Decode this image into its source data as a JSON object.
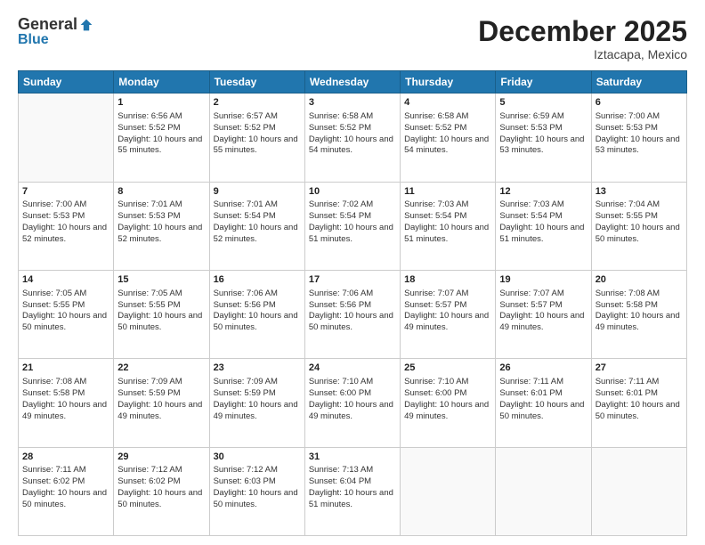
{
  "header": {
    "logo_general": "General",
    "logo_blue": "Blue",
    "month": "December 2025",
    "location": "Iztacapa, Mexico"
  },
  "days_of_week": [
    "Sunday",
    "Monday",
    "Tuesday",
    "Wednesday",
    "Thursday",
    "Friday",
    "Saturday"
  ],
  "weeks": [
    [
      {
        "day": "",
        "sunrise": "",
        "sunset": "",
        "daylight": ""
      },
      {
        "day": "1",
        "sunrise": "Sunrise: 6:56 AM",
        "sunset": "Sunset: 5:52 PM",
        "daylight": "Daylight: 10 hours and 55 minutes."
      },
      {
        "day": "2",
        "sunrise": "Sunrise: 6:57 AM",
        "sunset": "Sunset: 5:52 PM",
        "daylight": "Daylight: 10 hours and 55 minutes."
      },
      {
        "day": "3",
        "sunrise": "Sunrise: 6:58 AM",
        "sunset": "Sunset: 5:52 PM",
        "daylight": "Daylight: 10 hours and 54 minutes."
      },
      {
        "day": "4",
        "sunrise": "Sunrise: 6:58 AM",
        "sunset": "Sunset: 5:52 PM",
        "daylight": "Daylight: 10 hours and 54 minutes."
      },
      {
        "day": "5",
        "sunrise": "Sunrise: 6:59 AM",
        "sunset": "Sunset: 5:53 PM",
        "daylight": "Daylight: 10 hours and 53 minutes."
      },
      {
        "day": "6",
        "sunrise": "Sunrise: 7:00 AM",
        "sunset": "Sunset: 5:53 PM",
        "daylight": "Daylight: 10 hours and 53 minutes."
      }
    ],
    [
      {
        "day": "7",
        "sunrise": "Sunrise: 7:00 AM",
        "sunset": "Sunset: 5:53 PM",
        "daylight": "Daylight: 10 hours and 52 minutes."
      },
      {
        "day": "8",
        "sunrise": "Sunrise: 7:01 AM",
        "sunset": "Sunset: 5:53 PM",
        "daylight": "Daylight: 10 hours and 52 minutes."
      },
      {
        "day": "9",
        "sunrise": "Sunrise: 7:01 AM",
        "sunset": "Sunset: 5:54 PM",
        "daylight": "Daylight: 10 hours and 52 minutes."
      },
      {
        "day": "10",
        "sunrise": "Sunrise: 7:02 AM",
        "sunset": "Sunset: 5:54 PM",
        "daylight": "Daylight: 10 hours and 51 minutes."
      },
      {
        "day": "11",
        "sunrise": "Sunrise: 7:03 AM",
        "sunset": "Sunset: 5:54 PM",
        "daylight": "Daylight: 10 hours and 51 minutes."
      },
      {
        "day": "12",
        "sunrise": "Sunrise: 7:03 AM",
        "sunset": "Sunset: 5:54 PM",
        "daylight": "Daylight: 10 hours and 51 minutes."
      },
      {
        "day": "13",
        "sunrise": "Sunrise: 7:04 AM",
        "sunset": "Sunset: 5:55 PM",
        "daylight": "Daylight: 10 hours and 50 minutes."
      }
    ],
    [
      {
        "day": "14",
        "sunrise": "Sunrise: 7:05 AM",
        "sunset": "Sunset: 5:55 PM",
        "daylight": "Daylight: 10 hours and 50 minutes."
      },
      {
        "day": "15",
        "sunrise": "Sunrise: 7:05 AM",
        "sunset": "Sunset: 5:55 PM",
        "daylight": "Daylight: 10 hours and 50 minutes."
      },
      {
        "day": "16",
        "sunrise": "Sunrise: 7:06 AM",
        "sunset": "Sunset: 5:56 PM",
        "daylight": "Daylight: 10 hours and 50 minutes."
      },
      {
        "day": "17",
        "sunrise": "Sunrise: 7:06 AM",
        "sunset": "Sunset: 5:56 PM",
        "daylight": "Daylight: 10 hours and 50 minutes."
      },
      {
        "day": "18",
        "sunrise": "Sunrise: 7:07 AM",
        "sunset": "Sunset: 5:57 PM",
        "daylight": "Daylight: 10 hours and 49 minutes."
      },
      {
        "day": "19",
        "sunrise": "Sunrise: 7:07 AM",
        "sunset": "Sunset: 5:57 PM",
        "daylight": "Daylight: 10 hours and 49 minutes."
      },
      {
        "day": "20",
        "sunrise": "Sunrise: 7:08 AM",
        "sunset": "Sunset: 5:58 PM",
        "daylight": "Daylight: 10 hours and 49 minutes."
      }
    ],
    [
      {
        "day": "21",
        "sunrise": "Sunrise: 7:08 AM",
        "sunset": "Sunset: 5:58 PM",
        "daylight": "Daylight: 10 hours and 49 minutes."
      },
      {
        "day": "22",
        "sunrise": "Sunrise: 7:09 AM",
        "sunset": "Sunset: 5:59 PM",
        "daylight": "Daylight: 10 hours and 49 minutes."
      },
      {
        "day": "23",
        "sunrise": "Sunrise: 7:09 AM",
        "sunset": "Sunset: 5:59 PM",
        "daylight": "Daylight: 10 hours and 49 minutes."
      },
      {
        "day": "24",
        "sunrise": "Sunrise: 7:10 AM",
        "sunset": "Sunset: 6:00 PM",
        "daylight": "Daylight: 10 hours and 49 minutes."
      },
      {
        "day": "25",
        "sunrise": "Sunrise: 7:10 AM",
        "sunset": "Sunset: 6:00 PM",
        "daylight": "Daylight: 10 hours and 49 minutes."
      },
      {
        "day": "26",
        "sunrise": "Sunrise: 7:11 AM",
        "sunset": "Sunset: 6:01 PM",
        "daylight": "Daylight: 10 hours and 50 minutes."
      },
      {
        "day": "27",
        "sunrise": "Sunrise: 7:11 AM",
        "sunset": "Sunset: 6:01 PM",
        "daylight": "Daylight: 10 hours and 50 minutes."
      }
    ],
    [
      {
        "day": "28",
        "sunrise": "Sunrise: 7:11 AM",
        "sunset": "Sunset: 6:02 PM",
        "daylight": "Daylight: 10 hours and 50 minutes."
      },
      {
        "day": "29",
        "sunrise": "Sunrise: 7:12 AM",
        "sunset": "Sunset: 6:02 PM",
        "daylight": "Daylight: 10 hours and 50 minutes."
      },
      {
        "day": "30",
        "sunrise": "Sunrise: 7:12 AM",
        "sunset": "Sunset: 6:03 PM",
        "daylight": "Daylight: 10 hours and 50 minutes."
      },
      {
        "day": "31",
        "sunrise": "Sunrise: 7:13 AM",
        "sunset": "Sunset: 6:04 PM",
        "daylight": "Daylight: 10 hours and 51 minutes."
      },
      {
        "day": "",
        "sunrise": "",
        "sunset": "",
        "daylight": ""
      },
      {
        "day": "",
        "sunrise": "",
        "sunset": "",
        "daylight": ""
      },
      {
        "day": "",
        "sunrise": "",
        "sunset": "",
        "daylight": ""
      }
    ]
  ]
}
